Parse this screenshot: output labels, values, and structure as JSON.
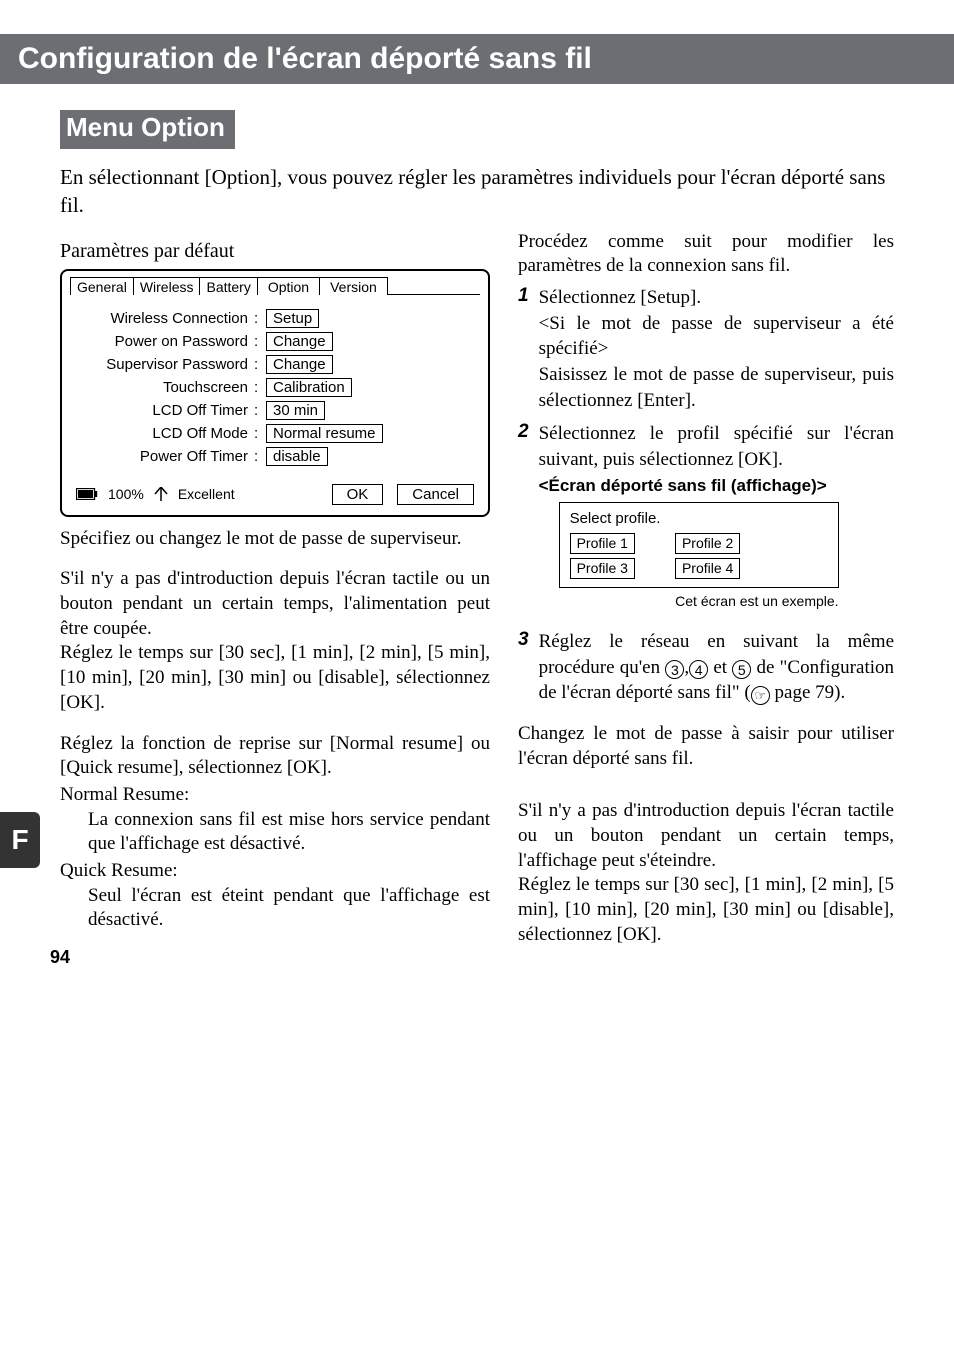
{
  "title": "Configuration de l'écran déporté sans fil",
  "section_heading": "Menu Option",
  "intro": "En sélectionnant [Option], vous pouvez régler les paramètres individuels pour l'écran déporté sans fil.",
  "left": {
    "defaults_label": "Paramètres par défaut",
    "tabs": {
      "general": "General",
      "wireless": "Wireless",
      "battery": "Battery",
      "option": "Option",
      "version": "Version"
    },
    "rows": {
      "wireless_connection": {
        "label": "Wireless Connection",
        "value": "Setup"
      },
      "power_on_password": {
        "label": "Power on Password",
        "value": "Change"
      },
      "supervisor_password": {
        "label": "Supervisor Password",
        "value": "Change"
      },
      "touchscreen": {
        "label": "Touchscreen",
        "value": "Calibration"
      },
      "lcd_off_timer": {
        "label": "LCD Off Timer",
        "value": "30 min"
      },
      "lcd_off_mode": {
        "label": "LCD Off Mode",
        "value": "Normal resume"
      },
      "power_off_timer": {
        "label": "Power Off Timer",
        "value": "disable"
      }
    },
    "status": {
      "battery": "100%",
      "signal": "Excellent"
    },
    "buttons": {
      "ok": "OK",
      "cancel": "Cancel"
    },
    "note_supervisor": "Spécifiez ou changez le mot de passe de superviseur.",
    "note_power_off": "S'il n'y a pas d'introduction depuis l'écran tactile ou un bouton pendant un certain temps, l'alimentation peut être coupée.\nRéglez le temps sur [30 sec], [1 min], [2 min], [5 min], [10 min], [20 min], [30 min] ou [disable], sélectionnez [OK].",
    "note_lcd_mode_intro": "Réglez la fonction de reprise sur [Normal resume] ou [Quick resume], sélectionnez [OK].",
    "normal_resume_label": "Normal Resume:",
    "normal_resume_body": "La connexion sans fil est mise hors service pendant que l'affichage est désactivé.",
    "quick_resume_label": "Quick Resume:",
    "quick_resume_body": "Seul l'écran est éteint pendant que l'affichage est désactivé."
  },
  "right": {
    "lead": "Procédez comme suit pour modifier les paramètres de la connexion sans fil.",
    "step1_a": "Sélectionnez [Setup].",
    "step1_b": "<Si le mot de passe de superviseur a été spécifié>",
    "step1_c": "Saisissez le mot de passe de superviseur, puis sélectionnez [Enter].",
    "step2_a": "Sélectionnez le profil spécifié sur l'écran suivant, puis sélectionnez [OK].",
    "step2_title": "<Écran déporté sans fil (affichage)>",
    "profile_prompt": "Select profile.",
    "profiles": {
      "p1": "Profile 1",
      "p2": "Profile 2",
      "p3": "Profile 3",
      "p4": "Profile 4"
    },
    "profile_caption": "Cet écran est un exemple.",
    "step3_a": "Réglez le réseau en suivant la même procédure qu'en ",
    "step3_b": " et ",
    "step3_c": " de \"Configuration de l'écran déporté sans fil\" (",
    "step3_page": " page 79).",
    "note_change_pw": "Changez le mot de passe à saisir pour utiliser l'écran déporté sans fil.",
    "note_lcd_timer": "S'il n'y a pas d'introduction depuis l'écran tactile ou un bouton pendant un certain temps, l'affichage peut s'éteindre.\nRéglez le temps sur [30 sec], [1 min], [2 min], [5 min], [10 min], [20 min], [30 min] ou [disable], sélectionnez [OK]."
  },
  "side_tab": "F",
  "page_number": "94"
}
